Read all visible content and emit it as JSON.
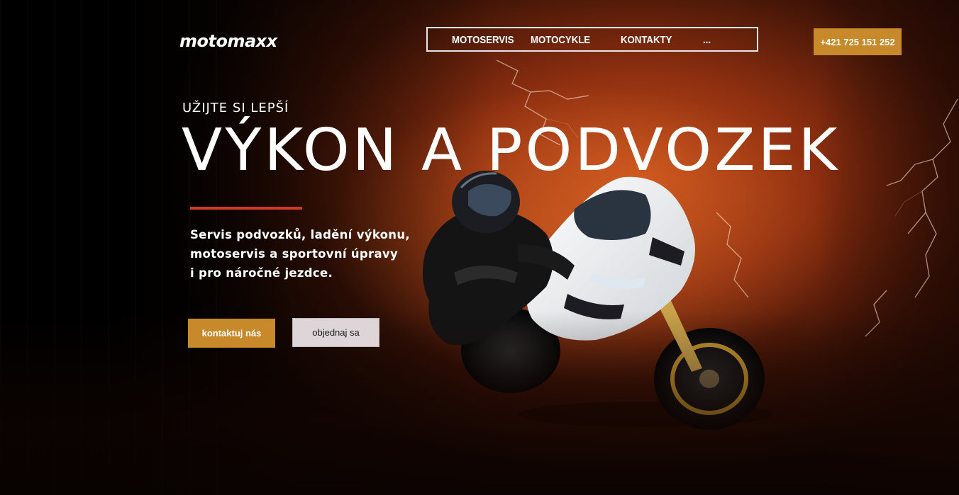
{
  "header": {
    "logo_text": "motomaxx",
    "nav": [
      {
        "label": "MOTOSERVIS"
      },
      {
        "label": "MOTOCYKLE"
      },
      {
        "label": "KONTAKTY"
      },
      {
        "label": "..."
      }
    ],
    "phone": "+421 725 151 252"
  },
  "hero": {
    "kicker": "UŽIJTE SI LEPŠÍ",
    "headline": "VÝKON A PODVOZEK",
    "description_lines": [
      "Servis podvozků, ladění výkonu,",
      "motoservis a sportovní úpravy",
      "i pro náročné jezdce."
    ],
    "primary_button": "kontaktuj nás",
    "secondary_button": "objednaj sa"
  },
  "colors": {
    "accent": "#c7892a",
    "red_accent": "#d03a22",
    "secondary_button_bg": "#ddd5d8",
    "background_dark": "#000000",
    "sky_orange": "#c4501c"
  },
  "icons": {
    "hero_image": "motorcycle-rider-image",
    "background": "storm-lightning-sky"
  }
}
